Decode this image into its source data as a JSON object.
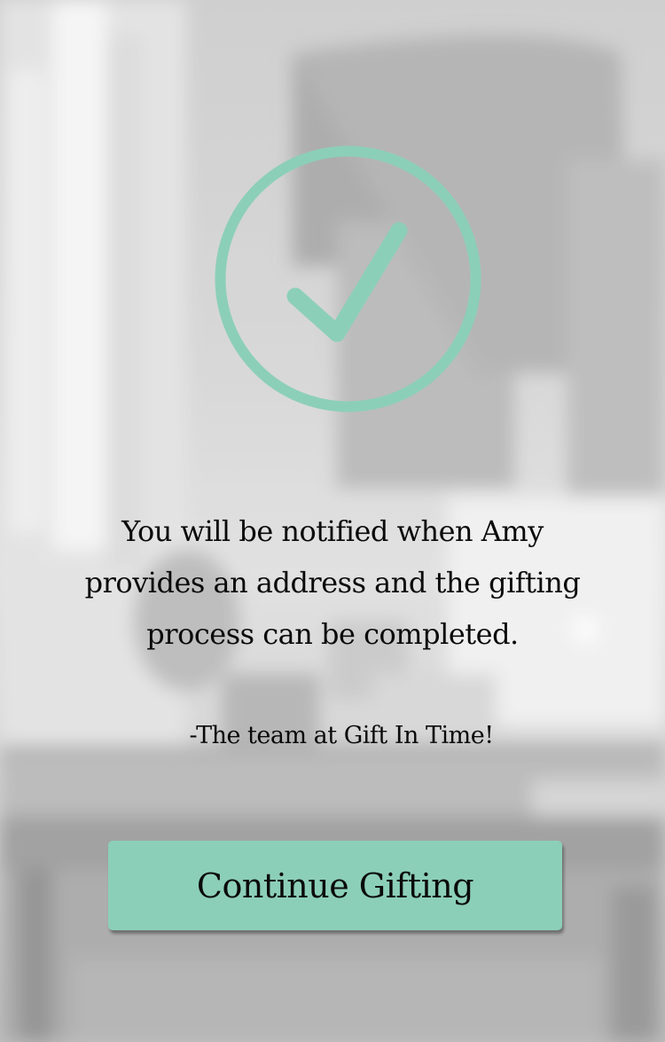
{
  "status": {
    "icon": "checkmark-circle-icon",
    "accent_color": "#8ccfb8"
  },
  "message": {
    "lines": [
      "You will be notified when Amy",
      "provides an address and the gifting",
      "process can be completed."
    ],
    "signature": "-The team at Gift In Time!"
  },
  "actions": {
    "continue_label": "Continue Gifting"
  },
  "background": {
    "description_icon": "blurred-desk-photo"
  }
}
